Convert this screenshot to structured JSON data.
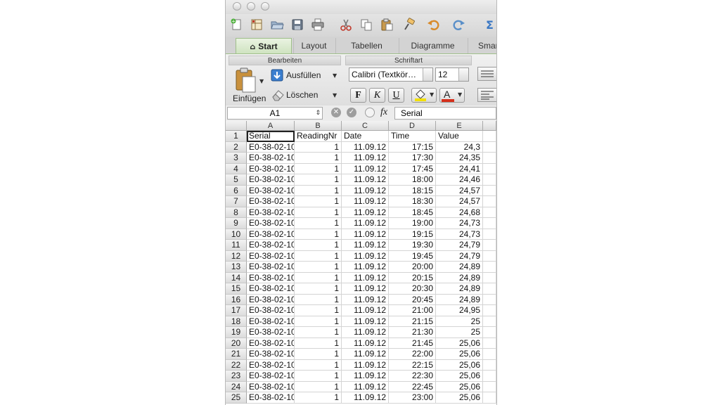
{
  "toolbar": {
    "icons": [
      "new-workbook-icon",
      "templates-icon",
      "open-icon",
      "save-icon",
      "print-icon",
      "cut-icon",
      "copy-icon",
      "paste-icon",
      "format-brush-icon",
      "undo-icon",
      "redo-icon",
      "sum-icon"
    ]
  },
  "tabs": [
    {
      "label": "Start",
      "active": true
    },
    {
      "label": "Layout"
    },
    {
      "label": "Tabellen"
    },
    {
      "label": "Diagramme"
    },
    {
      "label": "Smar"
    }
  ],
  "ribbon": {
    "groups": {
      "edit": "Bearbeiten",
      "font": "Schriftart"
    },
    "paste_label": "Einfügen",
    "fill_label": "Ausfüllen",
    "clear_label": "Löschen",
    "font_name": "Calibri (Textkör…",
    "font_size": "12",
    "bold_label": "F",
    "italic_label": "K",
    "underline_label": "U",
    "font_color_label": "A",
    "colors": {
      "fill": "#f2e000",
      "font": "#d6301c",
      "accent": "#9fbf8a"
    }
  },
  "formula_bar": {
    "name_box": "A1",
    "fx_label": "fx",
    "content": "Serial"
  },
  "grid": {
    "columns": [
      "A",
      "B",
      "C",
      "D",
      "E"
    ],
    "header": [
      "Serial",
      "ReadingNr",
      "Date",
      "Time",
      "Value"
    ],
    "rows": [
      [
        "2",
        "E0-38-02-10-",
        "1",
        "11.09.12",
        "17:15",
        "24,3"
      ],
      [
        "3",
        "E0-38-02-10-",
        "1",
        "11.09.12",
        "17:30",
        "24,35"
      ],
      [
        "4",
        "E0-38-02-10-",
        "1",
        "11.09.12",
        "17:45",
        "24,41"
      ],
      [
        "5",
        "E0-38-02-10-",
        "1",
        "11.09.12",
        "18:00",
        "24,46"
      ],
      [
        "6",
        "E0-38-02-10-",
        "1",
        "11.09.12",
        "18:15",
        "24,57"
      ],
      [
        "7",
        "E0-38-02-10-",
        "1",
        "11.09.12",
        "18:30",
        "24,57"
      ],
      [
        "8",
        "E0-38-02-10-",
        "1",
        "11.09.12",
        "18:45",
        "24,68"
      ],
      [
        "9",
        "E0-38-02-10-",
        "1",
        "11.09.12",
        "19:00",
        "24,73"
      ],
      [
        "10",
        "E0-38-02-10-",
        "1",
        "11.09.12",
        "19:15",
        "24,73"
      ],
      [
        "11",
        "E0-38-02-10-",
        "1",
        "11.09.12",
        "19:30",
        "24,79"
      ],
      [
        "12",
        "E0-38-02-10-",
        "1",
        "11.09.12",
        "19:45",
        "24,79"
      ],
      [
        "13",
        "E0-38-02-10-",
        "1",
        "11.09.12",
        "20:00",
        "24,89"
      ],
      [
        "14",
        "E0-38-02-10-",
        "1",
        "11.09.12",
        "20:15",
        "24,89"
      ],
      [
        "15",
        "E0-38-02-10-",
        "1",
        "11.09.12",
        "20:30",
        "24,89"
      ],
      [
        "16",
        "E0-38-02-10-",
        "1",
        "11.09.12",
        "20:45",
        "24,89"
      ],
      [
        "17",
        "E0-38-02-10-",
        "1",
        "11.09.12",
        "21:00",
        "24,95"
      ],
      [
        "18",
        "E0-38-02-10-",
        "1",
        "11.09.12",
        "21:15",
        "25"
      ],
      [
        "19",
        "E0-38-02-10-",
        "1",
        "11.09.12",
        "21:30",
        "25"
      ],
      [
        "20",
        "E0-38-02-10-",
        "1",
        "11.09.12",
        "21:45",
        "25,06"
      ],
      [
        "21",
        "E0-38-02-10-",
        "1",
        "11.09.12",
        "22:00",
        "25,06"
      ],
      [
        "22",
        "E0-38-02-10-",
        "1",
        "11.09.12",
        "22:15",
        "25,06"
      ],
      [
        "23",
        "E0-38-02-10-",
        "1",
        "11.09.12",
        "22:30",
        "25,06"
      ],
      [
        "24",
        "E0-38-02-10-",
        "1",
        "11.09.12",
        "22:45",
        "25,06"
      ],
      [
        "25",
        "E0-38-02-10-",
        "1",
        "11.09.12",
        "23:00",
        "25,06"
      ]
    ]
  }
}
